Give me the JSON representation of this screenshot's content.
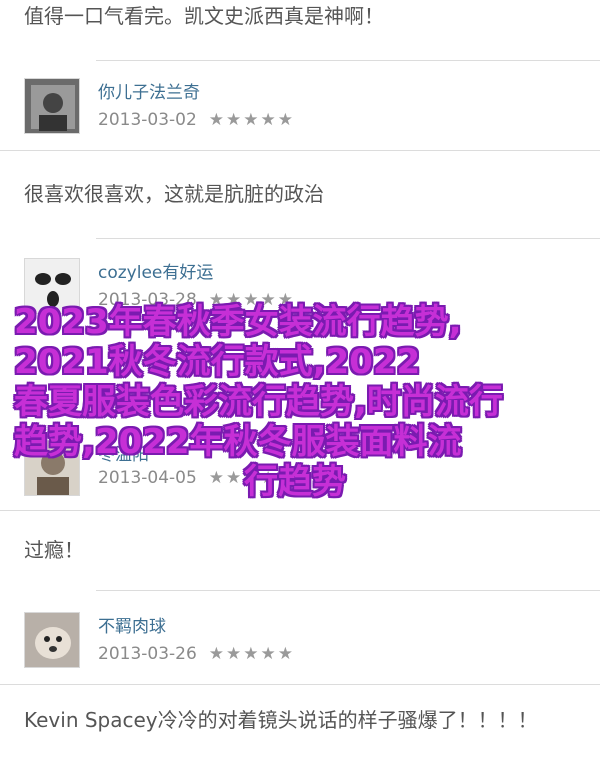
{
  "comments": [
    {
      "text": "值得一口气看完。凯文史派西真是神啊！"
    },
    {
      "user": "你儿子法兰奇",
      "date": "2013-03-02",
      "stars": "★★★★★",
      "text": "很喜欢很喜欢，这就是肮脏的政治"
    },
    {
      "user": "cozylee有好运",
      "date": "2013-03-28",
      "stars": "★★★★★"
    },
    {
      "user": "冬温阳",
      "date": "2013-04-05",
      "stars": "★★★★★",
      "text": "过瘾！"
    },
    {
      "user": "不羁肉球",
      "date": "2013-03-26",
      "stars": "★★★★★",
      "text": "Kevin Spacey冷冷的对着镜头说话的样子骚爆了！！！！"
    }
  ],
  "overlay": {
    "lines": [
      "2023年春秋季女装流行趋势,",
      "2021秋冬流行款式,2022",
      "春夏服装色彩流行趋势,时尚流行",
      "趋势,2022年秋冬服装面料流",
      "行趋势"
    ]
  },
  "colors": {
    "accent": "#3d6f92",
    "overlay_fill": "#c62fd6",
    "overlay_stroke": "#7a1bb0"
  }
}
